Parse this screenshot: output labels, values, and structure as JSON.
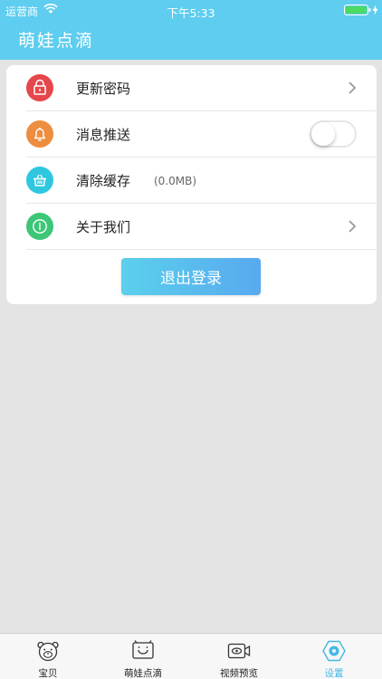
{
  "status": {
    "carrier": "运营商",
    "time": "下午5:33"
  },
  "header": {
    "title": "萌娃点滴"
  },
  "settings": {
    "rows": [
      {
        "label": "更新密码",
        "icon": "lock-icon",
        "color": "#e4474c"
      },
      {
        "label": "消息推送",
        "icon": "bell-icon",
        "color": "#ec8d3f",
        "toggle_on": false
      },
      {
        "label": "清除缓存",
        "icon": "basket-icon",
        "color": "#2fc7e0",
        "sub": "(0.0MB)"
      },
      {
        "label": "关于我们",
        "icon": "info-icon",
        "color": "#3cc677"
      }
    ],
    "logout_label": "退出登录"
  },
  "tabs": [
    {
      "label": "宝贝",
      "icon": "bear-face-icon"
    },
    {
      "label": "萌娃点滴",
      "icon": "smile-tv-icon"
    },
    {
      "label": "视频预览",
      "icon": "camera-icon"
    },
    {
      "label": "设置",
      "icon": "settings-hex-icon",
      "active": true
    }
  ],
  "colors": {
    "header": "#5ecdef",
    "accent": "#43b8e2",
    "background": "#e4e4e4"
  }
}
